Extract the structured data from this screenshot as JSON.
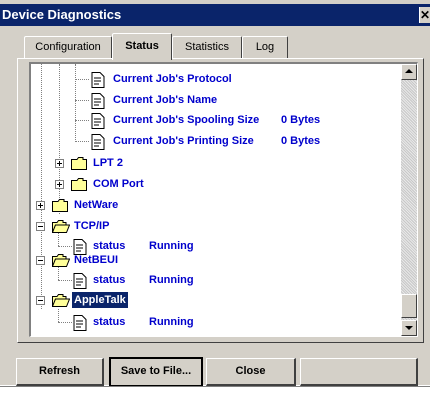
{
  "window": {
    "title": "Device Diagnostics",
    "close_glyph": "✕"
  },
  "tabs": [
    {
      "label": "Configuration",
      "active": false
    },
    {
      "label": "Status",
      "active": true
    },
    {
      "label": "Statistics",
      "active": false
    },
    {
      "label": "Log",
      "active": false
    }
  ],
  "tree": {
    "items": [
      {
        "label": "Current Job's Protocol",
        "value": "",
        "icon": "document-icon"
      },
      {
        "label": "Current Job's Name",
        "value": "",
        "icon": "document-icon"
      },
      {
        "label": "Current Job's Spooling Size",
        "value": "0 Bytes",
        "icon": "document-icon"
      },
      {
        "label": "Current Job's Printing Size",
        "value": "0 Bytes",
        "icon": "document-icon"
      },
      {
        "label": "LPT 2",
        "value": "",
        "icon": "folder-closed-icon",
        "expander": "plus"
      },
      {
        "label": "COM Port",
        "value": "",
        "icon": "folder-closed-icon",
        "expander": "plus"
      },
      {
        "label": "NetWare",
        "value": "",
        "icon": "folder-closed-icon",
        "expander": "plus"
      },
      {
        "label": "TCP/IP",
        "value": "",
        "icon": "folder-open-icon",
        "expander": "minus"
      },
      {
        "label": "status",
        "value": "Running",
        "icon": "document-icon"
      },
      {
        "label": "NetBEUI",
        "value": "",
        "icon": "folder-open-icon",
        "expander": "minus"
      },
      {
        "label": "status",
        "value": "Running",
        "icon": "document-icon"
      },
      {
        "label": "AppleTalk",
        "value": "",
        "icon": "folder-open-icon",
        "expander": "minus",
        "selected": true
      },
      {
        "label": "status",
        "value": "Running",
        "icon": "document-icon"
      }
    ]
  },
  "buttons": {
    "refresh": "Refresh",
    "save": "Save to File...",
    "close": "Close",
    "empty": ""
  },
  "colors": {
    "title_bar": "#0a246a",
    "tree_text": "#0000cc",
    "folder": "#ffff99",
    "dialog": "#d4d0c8"
  }
}
